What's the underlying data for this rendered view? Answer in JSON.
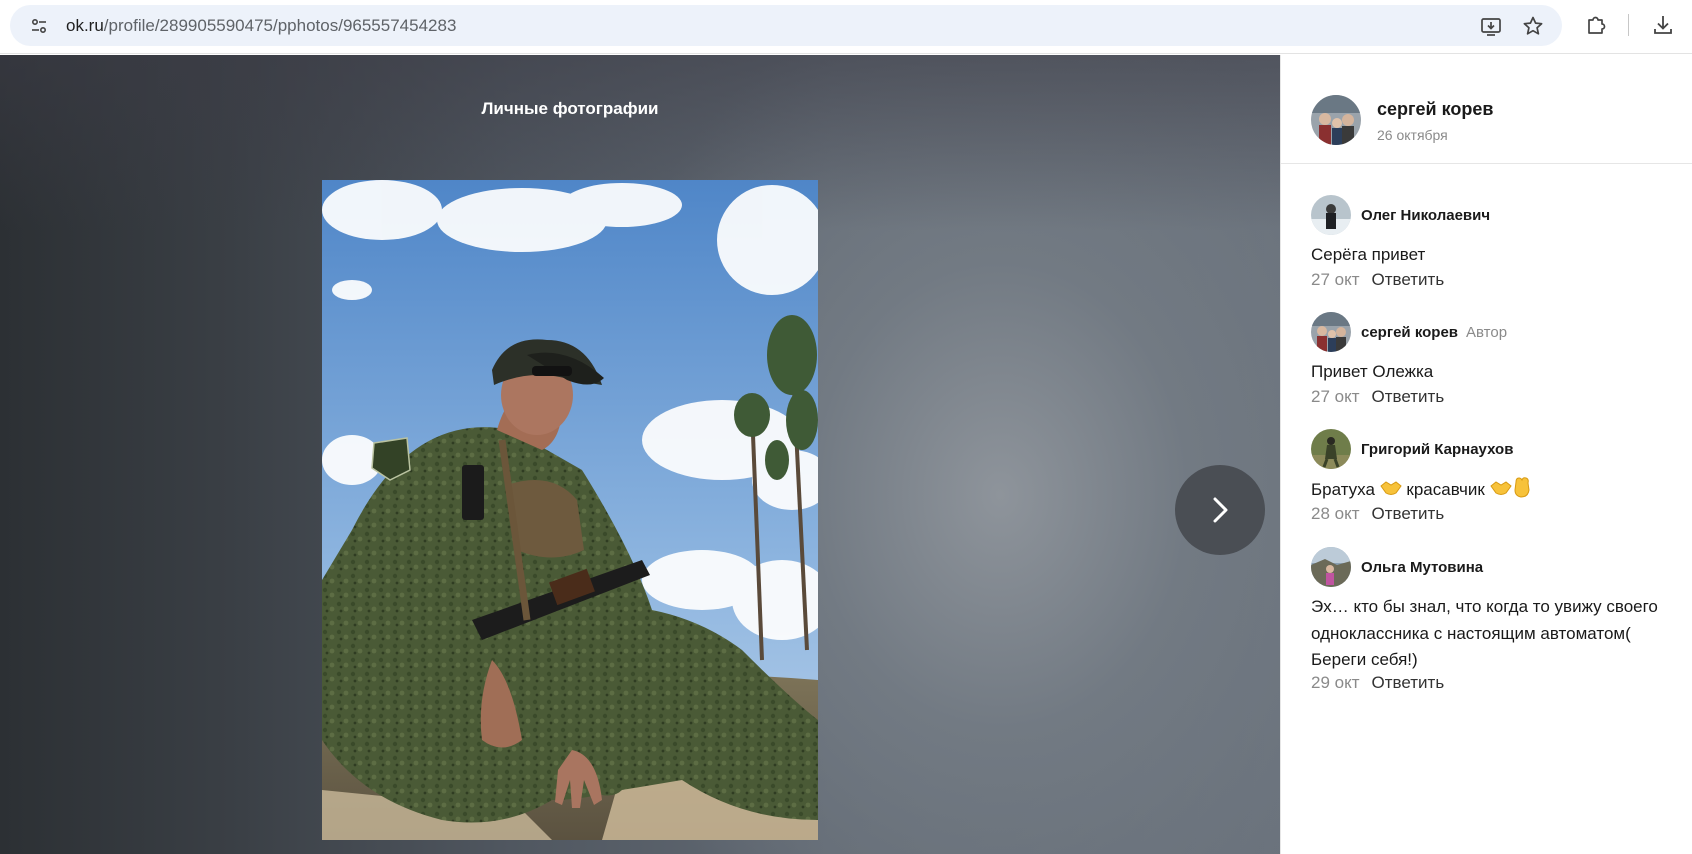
{
  "browser": {
    "url_host": "ok.ru",
    "url_path": "/profile/289905590475/pphotos/965557454283",
    "icons": [
      "site-info-icon",
      "install-app-icon",
      "bookmark-star-icon",
      "extensions-icon",
      "download-icon"
    ]
  },
  "viewer": {
    "album_title": "Личные фотографии",
    "next_icon": "chevron-right-icon"
  },
  "post": {
    "author_name": "сергей корев",
    "date": "26 октября"
  },
  "reply_label": "Ответить",
  "comments": [
    {
      "author": "Олег Николаевич",
      "badge": "",
      "text": "Серёга привет",
      "date": "27 окт"
    },
    {
      "author": "сергей корев",
      "badge": "Автор",
      "text": "Привет Олежка",
      "date": "27 окт"
    },
    {
      "author": "Григорий Карнаухов",
      "badge": "",
      "text_parts": [
        "Братуха",
        "красавчик"
      ],
      "emoji": [
        "handshake-emoji",
        "handshake-emoji",
        "raised-fist-emoji"
      ],
      "date": "28 окт"
    },
    {
      "author": "Ольга Мутовина",
      "badge": "",
      "text": "Эх… кто бы знал, что когда то увижу своего одноклассника с настоящим автоматом( Береги себя!)",
      "date": "29 окт"
    }
  ]
}
